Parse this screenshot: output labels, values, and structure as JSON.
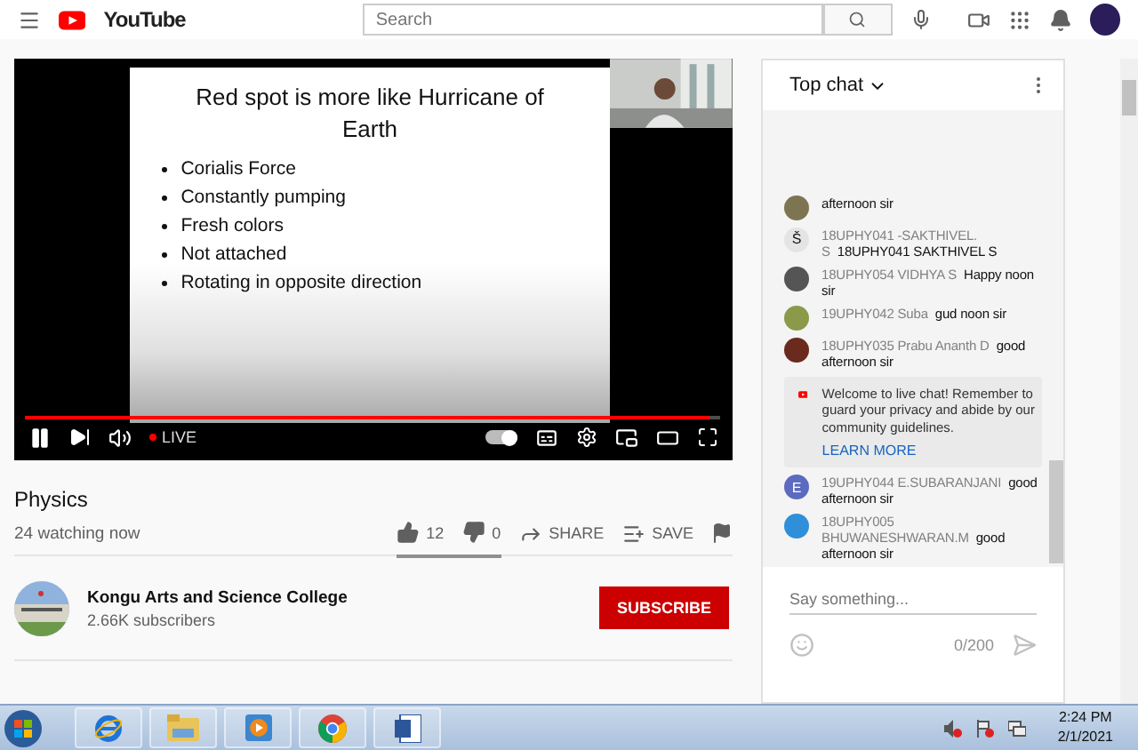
{
  "header": {
    "logo": "YouTube",
    "search": {
      "placeholder": "Search"
    }
  },
  "video": {
    "playing": true,
    "autoplay": true,
    "live_label": "LIVE",
    "level": 0.985,
    "slide": {
      "title": "Red spot is more like Hurricane of Earth",
      "bullets": [
        "Corialis Force",
        "Constantly pumping",
        "Fresh colors",
        "Not attached",
        "Rotating in opposite direction"
      ]
    }
  },
  "title": "Physics",
  "viewers": "24 watching now",
  "actions": [
    {
      "kind": "like",
      "label": "12"
    },
    {
      "kind": "dislike",
      "label": "0"
    },
    {
      "kind": "share",
      "label": "SHARE"
    },
    {
      "kind": "save",
      "label": "SAVE"
    },
    {
      "kind": "report"
    }
  ],
  "channel": {
    "name": "Kongu Arts and Science College",
    "subscribers": "2.66K subscribers",
    "subscribe": "SUBSCRIBE"
  },
  "chat": {
    "title": "Top chat",
    "messages": [
      {
        "kind": "message",
        "text": "afternoon sir",
        "color": "#7d7452"
      },
      {
        "kind": "message",
        "author": "18UPHY041 -SAKTHIVEL. S",
        "text": "18UPHY041 SAKTHIVEL S",
        "avatar_letter": "Š",
        "color": "#e4e4e4"
      },
      {
        "kind": "message",
        "author": "18UPHY054 VIDHYA S",
        "text": "Happy noon sir",
        "color": "#555555"
      },
      {
        "kind": "message",
        "author": "19UPHY042 Suba",
        "text": "gud noon sir",
        "color": "#8a9a4a"
      },
      {
        "kind": "message",
        "author": "18UPHY035 Prabu Ananth D",
        "text": "good afternoon sir",
        "color": "#6a2a1e"
      },
      {
        "kind": "notice",
        "text": "Welcome to live chat! Remember to guard your privacy and abide by our community guidelines.",
        "link": "LEARN MORE"
      },
      {
        "kind": "message",
        "author": "19UPHY044 E.SUBARANJANI",
        "text": "good afternoon sir",
        "avatar_letter": "E",
        "color": "#5c6bc0"
      },
      {
        "kind": "message",
        "author": "18UPHY005 BHUWANESHWARAN.M",
        "text": "good afternoon sir",
        "color": "#2f8fd8"
      }
    ],
    "input": {
      "placeholder": "Say something...",
      "counter": "0/200"
    }
  },
  "taskbar": {
    "apps": [
      {
        "kind": "ie"
      },
      {
        "kind": "explorer"
      },
      {
        "kind": "media"
      },
      {
        "kind": "chrome"
      },
      {
        "kind": "word"
      }
    ],
    "time": "2:24 PM",
    "date": "2/1/2021"
  }
}
